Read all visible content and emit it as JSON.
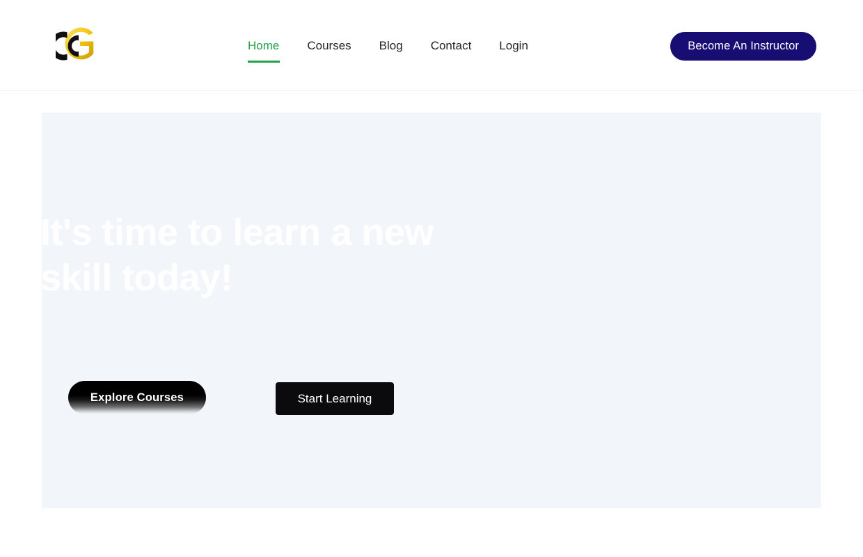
{
  "header": {
    "logo": {
      "icon": "cg-monogram-logo",
      "colors": {
        "mark_dark": "#111111",
        "mark_gold": "#f4c416"
      }
    },
    "nav": [
      {
        "label": "Home",
        "name": "nav-item-home",
        "active": true
      },
      {
        "label": "Courses",
        "name": "nav-item-courses",
        "active": false
      },
      {
        "label": "Blog",
        "name": "nav-item-blog",
        "active": false
      },
      {
        "label": "Contact",
        "name": "nav-item-contact",
        "active": false
      },
      {
        "label": "Login",
        "name": "nav-item-login",
        "active": false
      }
    ],
    "cta": {
      "label": "Become An Instructor",
      "background": "#180d73",
      "text_color": "#ffffff"
    },
    "active_color": "#22a14a"
  },
  "hero": {
    "background": "#f2f5f9",
    "heading": "It's time to learn a new\nskill today!",
    "subtitle": "",
    "buttons": {
      "primary": {
        "label": "Explore Courses",
        "style": "black-gradient-pill"
      },
      "secondary": {
        "label": "Start Learning",
        "style": "black-rect"
      }
    }
  }
}
